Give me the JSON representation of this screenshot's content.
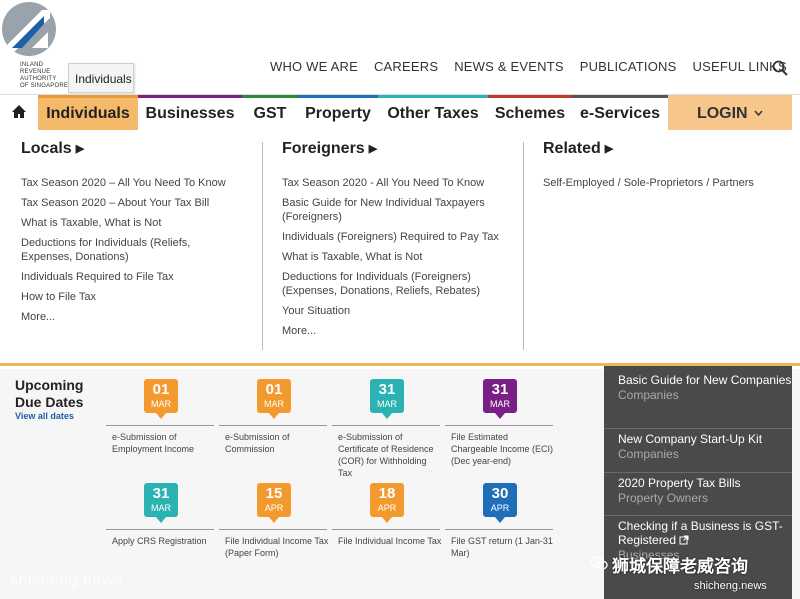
{
  "logo": {
    "lines": [
      "INLAND REVENUE",
      "AUTHORITY",
      "OF SINGAPORE"
    ]
  },
  "tooltip": "Individuals",
  "topnav": [
    "WHO WE ARE",
    "CAREERS",
    "NEWS & EVENTS",
    "PUBLICATIONS",
    "USEFUL LINKS"
  ],
  "mainnav": {
    "items": [
      "Individuals",
      "Businesses",
      "GST",
      "Property",
      "Other Taxes",
      "Schemes",
      "e-Services"
    ],
    "login": "LOGIN",
    "colors": {
      "active_bg": "#f5b96a",
      "login_bg": "#f7c68a"
    }
  },
  "mega": {
    "locals": {
      "title": "Locals",
      "items": [
        "Tax Season 2020 – All You Need To Know",
        "Tax Season 2020 – About Your Tax Bill",
        "What is Taxable, What is Not",
        "Deductions for Individuals (Reliefs, Expenses, Donations)",
        "Individuals Required to File Tax",
        "How to File Tax",
        "More..."
      ]
    },
    "foreigners": {
      "title": "Foreigners",
      "items": [
        "Tax Season 2020 - All You Need To Know",
        "Basic Guide for New Individual Taxpayers (Foreigners)",
        "Individuals (Foreigners) Required to Pay Tax",
        "What is Taxable, What is Not",
        "Deductions for Individuals (Foreigners) (Expenses, Donations, Reliefs, Rebates)",
        "Your Situation",
        "More..."
      ]
    },
    "related": {
      "title": "Related",
      "items": [
        "Self-Employed / Sole-Proprietors / Partners"
      ]
    }
  },
  "due_dates": {
    "title_line1": "Upcoming",
    "title_line2": "Due Dates",
    "view_all": "View all dates",
    "items": [
      {
        "day": "01",
        "month": "MAR",
        "color": "#f39a2e",
        "text": "e-Submission of Employment Income"
      },
      {
        "day": "01",
        "month": "MAR",
        "color": "#f39a2e",
        "text": "e-Submission of Commission"
      },
      {
        "day": "31",
        "month": "MAR",
        "color": "#2bb3b3",
        "text": "e-Submission of Certificate of Residence (COR) for Withholding Tax"
      },
      {
        "day": "31",
        "month": "MAR",
        "color": "#7a1f86",
        "text": "File Estimated Chargeable Income (ECI) (Dec year-end)"
      },
      {
        "day": "31",
        "month": "MAR",
        "color": "#2bb3b3",
        "text": "Apply CRS Registration"
      },
      {
        "day": "15",
        "month": "APR",
        "color": "#f39a2e",
        "text": "File Individual Income Tax (Paper Form)"
      },
      {
        "day": "18",
        "month": "APR",
        "color": "#f39a2e",
        "text": "File Individual Income Tax"
      },
      {
        "day": "30",
        "month": "APR",
        "color": "#1f6fb8",
        "text": "File GST return (1 Jan-31 Mar)"
      }
    ]
  },
  "sidebar": [
    {
      "title": "Basic Guide for New Companies",
      "sub": "Companies"
    },
    {
      "title": "New Company Start-Up Kit",
      "sub": "Companies"
    },
    {
      "title": "2020 Property Tax Bills",
      "sub": "Property Owners"
    },
    {
      "title": "Checking if a Business is GST-Registered",
      "sub": "Businesses"
    }
  ],
  "watermarks": {
    "left": "shicheng.news",
    "cn": "狮城保障老威咨询",
    "right": "shicheng.news"
  }
}
